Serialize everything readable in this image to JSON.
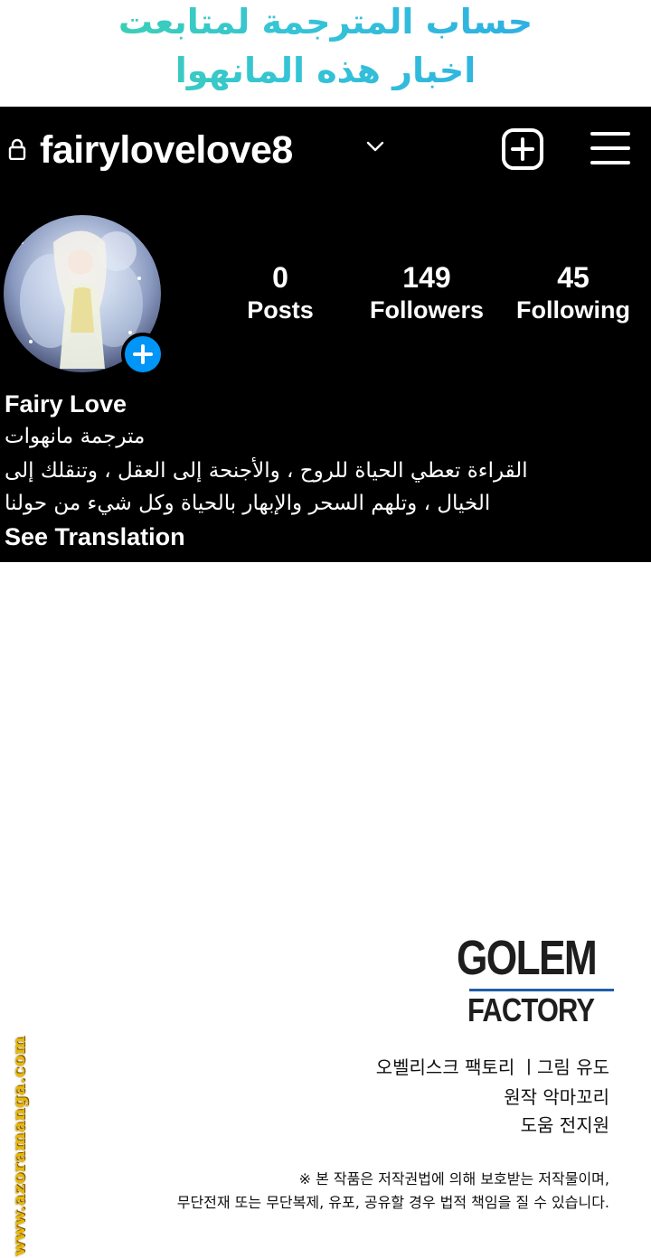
{
  "banner": {
    "line1": "حساب المترجمة لمتابعت",
    "line2": "اخبار هذه المانهوا"
  },
  "topbar": {
    "username": "fairylovelove8",
    "icons": [
      "lock-icon",
      "chevron-down-icon",
      "new-post-plus-icon",
      "menu-icon"
    ]
  },
  "stats": {
    "posts": {
      "value": "0",
      "label": "Posts"
    },
    "followers": {
      "value": "149",
      "label": "Followers"
    },
    "following": {
      "value": "45",
      "label": "Following"
    }
  },
  "bio": {
    "name": "Fairy Love",
    "line1": "مترجمة مانهوات",
    "line2": "القراءة تعطي الحياة للروح ، والأجنحة إلى العقل ، وتنقلك إلى",
    "line3": "الخيال ، وتلهم السحر والإبهار بالحياة وكل شيء من حولنا",
    "see_translation": "See Translation"
  },
  "colors": {
    "profile_bg": "#000000",
    "accent_blue": "#0095f6",
    "banner_gradient": [
      "#3fd6a0",
      "#2aa7e8"
    ],
    "watermark": "#e8b800"
  },
  "logo": {
    "top": "GOLEM",
    "bottom": "FACTORY"
  },
  "credits": {
    "line1": "오벨리스크 팩토리 ㅣ그림 유도",
    "line2": "원작 악마꼬리",
    "line3": "도움 전지원"
  },
  "notice": {
    "line1": "※ 본 작품은 저작권법에 의해 보호받는 저작물이며,",
    "line2": "무단전재 또는 무단복제, 유포, 공유할 경우 법적 책임을 질 수 있습니다."
  },
  "watermark": "www.azoramanga.com"
}
